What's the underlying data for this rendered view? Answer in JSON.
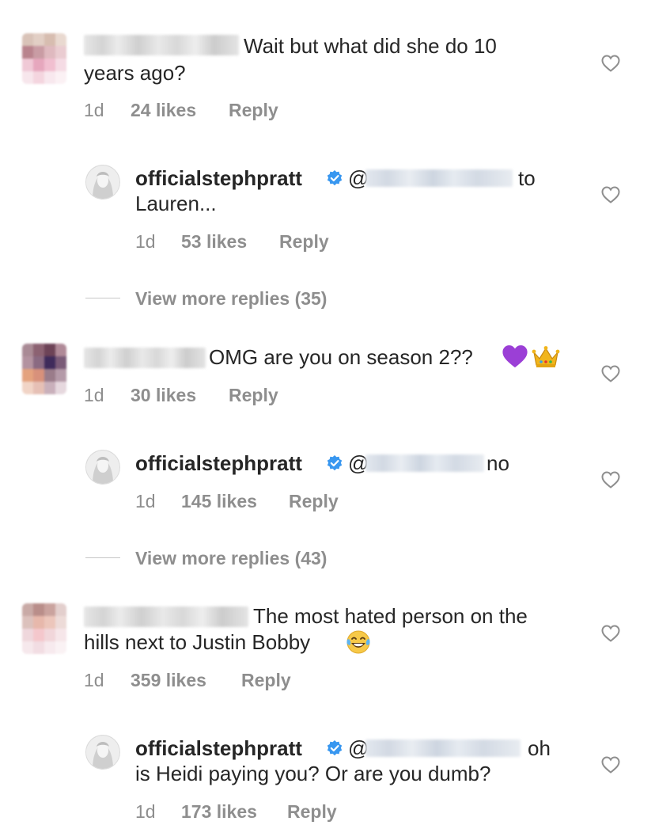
{
  "comments": [
    {
      "text_line1": "Wait but what did she do 10",
      "text_line2": "years ago?",
      "time": "1d",
      "likes": "24 likes",
      "reply": "Reply",
      "reply_thread": {
        "username": "officialstephpratt",
        "at": "@",
        "text_after": "to",
        "text_line2": "Lauren...",
        "time": "1d",
        "likes": "53 likes",
        "reply": "Reply"
      },
      "view_more": "View more replies (35)"
    },
    {
      "text_line1": "OMG are you on season 2??",
      "time": "1d",
      "likes": "30 likes",
      "reply": "Reply",
      "emojis": [
        "purple-heart-icon",
        "crown-icon"
      ],
      "reply_thread": {
        "username": "officialstephpratt",
        "at": "@",
        "text_after": "no",
        "time": "1d",
        "likes": "145 likes",
        "reply": "Reply"
      },
      "view_more": "View more replies (43)"
    },
    {
      "text_line1": "The most hated person on the",
      "text_line2": "hills next to Justin Bobby",
      "emojis": [
        "tears-of-joy-icon"
      ],
      "time": "1d",
      "likes": "359 likes",
      "reply": "Reply",
      "reply_thread": {
        "username": "officialstephpratt",
        "at": "@",
        "text_after": "oh",
        "text_line2": "is Heidi paying you? Or are you dumb?",
        "time": "1d",
        "likes": "173 likes",
        "reply": "Reply"
      }
    }
  ],
  "colors": {
    "text": "#262626",
    "meta": "#8e8e8e",
    "verified": "#3897f0",
    "heart_outline": "#8e8e8e",
    "purple_heart": "#9b3fd6",
    "crown": "#f1b51c"
  }
}
